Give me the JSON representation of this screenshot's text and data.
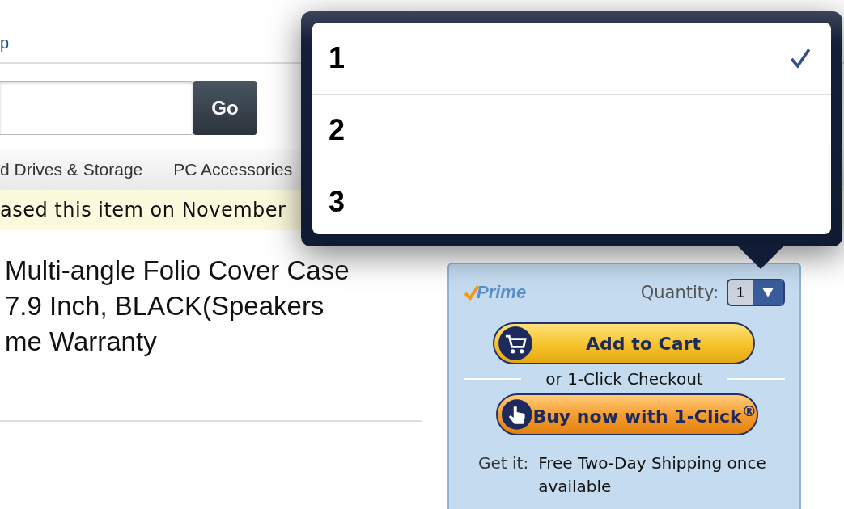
{
  "nav": {
    "link": "p"
  },
  "search": {
    "button": "Go"
  },
  "categories": [
    "d Drives & Storage",
    "PC Accessories"
  ],
  "notice": "ased this item on November",
  "product": {
    "title_lines": [
      "Multi-angle Folio Cover Case",
      "7.9 Inch, BLACK(Speakers",
      "me Warranty"
    ]
  },
  "buy_box": {
    "prime": "Prime",
    "quantity_label": "Quantity:",
    "quantity": "1",
    "add_to_cart": "Add to Cart",
    "divider_text": "or 1-Click Checkout",
    "buy_now": "Buy now with 1-Click$^{®}$",
    "get_it_label": "Get it:",
    "shipping": "Free Two-Day Shipping once available"
  },
  "quantity_menu": {
    "options": [
      {
        "label": "1",
        "selected": true
      },
      {
        "label": "2",
        "selected": false
      },
      {
        "label": "3",
        "selected": false
      }
    ]
  }
}
